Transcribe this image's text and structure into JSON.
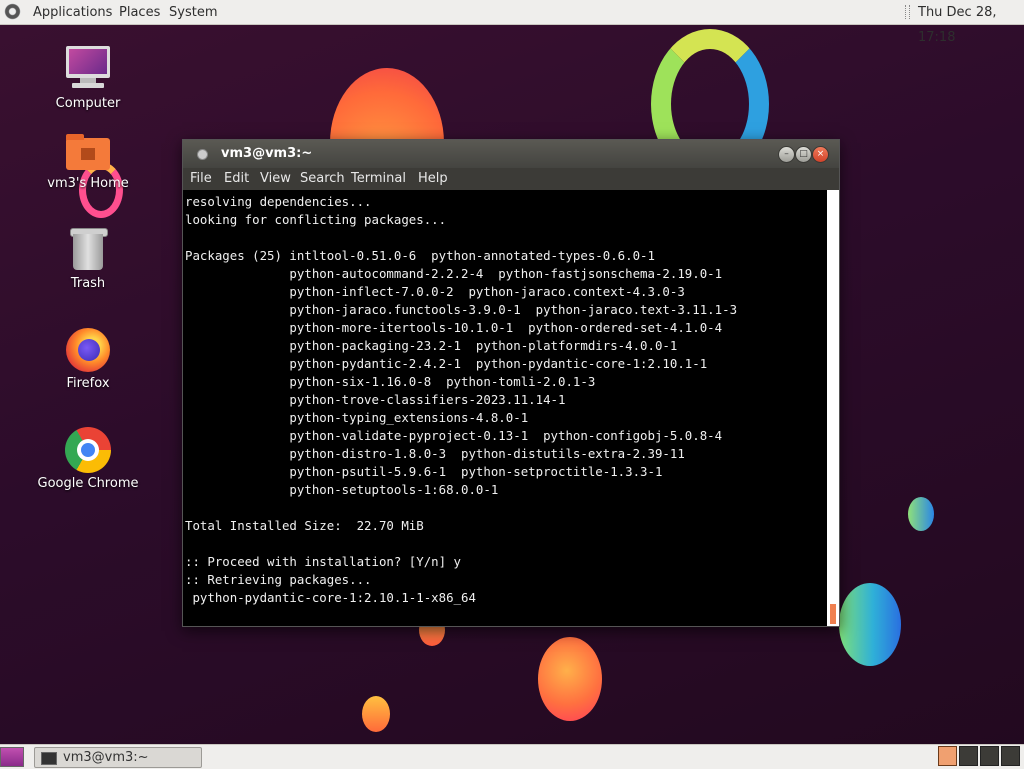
{
  "top_panel": {
    "applications": "Applications",
    "places": "Places",
    "system": "System",
    "clock": "Thu Dec 28, 17:18"
  },
  "desktop_icons": [
    {
      "label": "Computer",
      "icon": "computer-icon"
    },
    {
      "label": "vm3's Home",
      "icon": "home-folder-icon"
    },
    {
      "label": "Trash",
      "icon": "trash-icon"
    },
    {
      "label": "Firefox",
      "icon": "firefox-icon"
    },
    {
      "label": "Google Chrome",
      "icon": "chrome-icon"
    }
  ],
  "terminal": {
    "title": "vm3@vm3:~",
    "menu": [
      "File",
      "Edit",
      "View",
      "Search",
      "Terminal",
      "Help"
    ],
    "output": "resolving dependencies...\nlooking for conflicting packages...\n\nPackages (25) intltool-0.51.0-6  python-annotated-types-0.6.0-1\n              python-autocommand-2.2.2-4  python-fastjsonschema-2.19.0-1\n              python-inflect-7.0.0-2  python-jaraco.context-4.3.0-3\n              python-jaraco.functools-3.9.0-1  python-jaraco.text-3.11.1-3\n              python-more-itertools-10.1.0-1  python-ordered-set-4.1.0-4\n              python-packaging-23.2-1  python-platformdirs-4.0.0-1\n              python-pydantic-2.4.2-1  python-pydantic-core-1:2.10.1-1\n              python-six-1.16.0-8  python-tomli-2.0.1-3\n              python-trove-classifiers-2023.11.14-1\n              python-typing_extensions-4.8.0-1\n              python-validate-pyproject-0.13-1  python-configobj-5.0.8-4\n              python-distro-1.8.0-3  python-distutils-extra-2.39-11\n              python-psutil-5.9.6-1  python-setproctitle-1.3.3-1\n              python-setuptools-1:68.0.0-1\n\nTotal Installed Size:  22.70 MiB\n\n:: Proceed with installation? [Y/n] y\n:: Retrieving packages...\n python-pydantic-core-1:2.10.1-1-x86_64"
  },
  "bottom_panel": {
    "task_label": "vm3@vm3:~",
    "workspaces": 4,
    "active_workspace": 1
  }
}
